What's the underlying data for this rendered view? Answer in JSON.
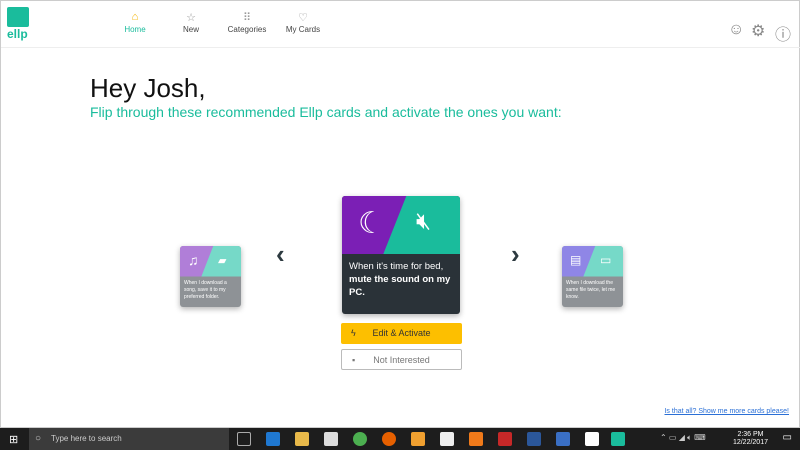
{
  "nav": {
    "items": [
      {
        "label": "Home",
        "icon": "home-icon"
      },
      {
        "label": "New",
        "icon": "star-icon"
      },
      {
        "label": "Categories",
        "icon": "grid-icon"
      },
      {
        "label": "My Cards",
        "icon": "heart-icon"
      }
    ]
  },
  "logo": "ellp",
  "greeting": "Hey Josh,",
  "subtitle": "Flip through these recommended Ellp cards and activate the ones you want:",
  "cards": {
    "left": {
      "text": "When I download a song, save it to my preferred folder.",
      "colors": [
        "#b07ed8",
        "#76d9c8"
      ]
    },
    "center": {
      "text_normal": "When it's time for bed,",
      "text_bold": "mute the sound on my PC.",
      "colors": [
        "#7b1fb5",
        "#1abc9c"
      ]
    },
    "right": {
      "text": "When I download the same file twice, let me know.",
      "colors": [
        "#8f86e6",
        "#76d9c8"
      ]
    }
  },
  "buttons": {
    "edit": "Edit & Activate",
    "not_interested": "Not Interested"
  },
  "more_link": "Is that all? Show me more cards please!",
  "taskbar": {
    "search_placeholder": "Type here to search",
    "time": "2:36 PM",
    "date": "12/22/2017"
  }
}
